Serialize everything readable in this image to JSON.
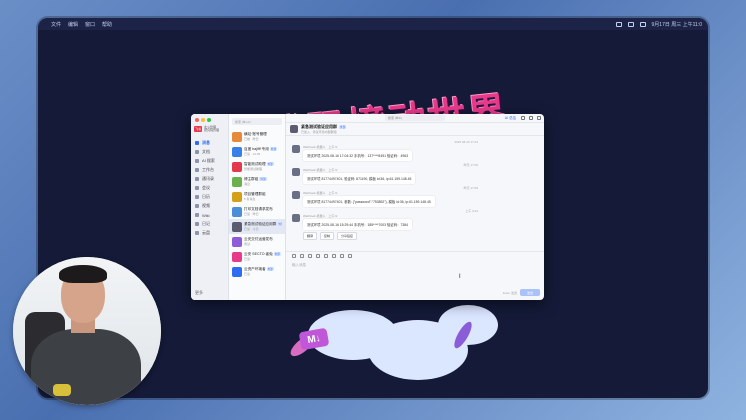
{
  "menubar": {
    "items": [
      "文件",
      "编辑",
      "窗口",
      "帮助"
    ],
    "right_time": "9月17日 周三 上午11:0"
  },
  "wallpaper": {
    "title": "代码撞动世界",
    "badge": "M↓"
  },
  "app": {
    "brand": {
      "logo": "飞书",
      "name": "北斗管理",
      "sub": "研究院管理"
    },
    "nav": [
      {
        "label": "消息",
        "active": true
      },
      {
        "label": "文档"
      },
      {
        "label": "AI 搜索"
      },
      {
        "label": "工作台"
      },
      {
        "label": "通讯录"
      },
      {
        "label": "会议"
      },
      {
        "label": "日历"
      },
      {
        "label": "视频"
      },
      {
        "label": "Wiki"
      },
      {
        "label": "日记"
      },
      {
        "label": "云盘"
      }
    ],
    "nav_bottom": "更多",
    "conv_search": "搜索 (⌘+K)",
    "conversations": [
      {
        "name": "横站·账号管理",
        "sub": "已被 · 昨日",
        "color": "#e58a3a"
      },
      {
        "name": "百度 hajifff 专用",
        "tag": "外部",
        "sub": "已读 · 12:33",
        "color": "#3a7ee8"
      },
      {
        "name": "智能测试助理",
        "tag": "外部",
        "sub": "智能测试助理",
        "color": "#e23a4c"
      },
      {
        "name": "博主群组",
        "tag": "外部",
        "sub": "消息",
        "color": "#6ab04c"
      },
      {
        "name": "项目管理群组",
        "sub": "5 条消息",
        "color": "#d4a017"
      },
      {
        "name": "打印文档请求发布",
        "sub": "已读 · 昨日",
        "color": "#4a90d9"
      },
      {
        "name": "紧急测试验证应用群",
        "tag": "外部",
        "sub": "已读 · 今日",
        "color": "#5c5c70",
        "selected": true
      },
      {
        "name": "云安交付运营发布",
        "sub": "测试",
        "color": "#8e5cd8"
      },
      {
        "name": "云安 SECTO 者免",
        "tag": "外部",
        "sub": "已读",
        "color": "#e83a8a"
      },
      {
        "name": "云资产环境者",
        "tag": "外部",
        "sub": "已读",
        "color": "#2f6bf0"
      }
    ],
    "chat": {
      "search": "搜索 (⌘K)",
      "ai_button": "AI 总结",
      "title": "紧急测试验证应用群",
      "title_tag": "外部",
      "subtitle": "已加入 · 测试环境内部群组",
      "messages": [
        {
          "time": "2025 08-16 17:04",
          "sender": "Webhook 机器人",
          "meta": "上午 9:",
          "text": "测试环境 2025-08-16 17:04:32 手机号：137****8491 验证码：4963"
        },
        {
          "time": "昨天 17:06",
          "sender": "Webhook 机器人",
          "meta": "上午 9:",
          "text": "测试环境 81774497401, 验证码: 871190, 模板 id:36, ip:61.159.148.45"
        },
        {
          "time": "昨天 17:09",
          "sender": "Webhook 机器人",
          "meta": "上午 9:",
          "text": "测试环境 81774497401, 参数: {\"password\":\"753892\"}, 模板 id:36, ip:61.159.148.45"
        },
        {
          "time": "上午 9:24",
          "sender": "Webhook 机器人",
          "meta": "上午 9:",
          "text": "测试环境 2025-08-16 15:29:44 手机号：185****7003 验证码：7384"
        }
      ],
      "quick_buttons": [
        "翻译",
        "复制",
        "分享链接"
      ],
      "input_placeholder": "输入消息",
      "send_hint": "Enter 发送",
      "send_label": "发送"
    }
  },
  "colors": {
    "accent": "#2f6bf0",
    "screen_bg": "#141a38",
    "title_pink": "#e83a8a"
  }
}
